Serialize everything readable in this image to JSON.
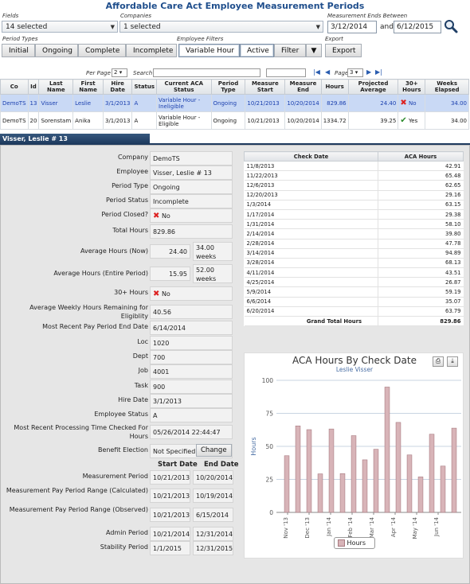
{
  "page": {
    "title": "Affordable Care Act Employee Measurement Periods"
  },
  "filters": {
    "fields_label": "Fields",
    "fields_value": "14 selected",
    "companies_label": "Companies",
    "companies_value": "1 selected",
    "measure_label": "Measurement Ends Between",
    "date_from": "3/12/2014",
    "and_label": "and",
    "date_to": "6/12/2015"
  },
  "period_types": {
    "label": "Period Types",
    "buttons": [
      "Initial",
      "Ongoing",
      "Complete",
      "Incomplete"
    ]
  },
  "employee_filters": {
    "label": "Employee Filters",
    "buttons": [
      "Variable Hour",
      "Active",
      "Filter"
    ]
  },
  "export": {
    "label": "Export",
    "button": "Export"
  },
  "pager": {
    "per_page_label": "Per Page",
    "per_page_value": "2",
    "search_label": "Search",
    "page_label": "Page",
    "page_value": "3"
  },
  "grid": {
    "headers": [
      "Co",
      "Id",
      "Last Name",
      "First Name",
      "Hire Date",
      "Status",
      "Current ACA Status",
      "Period Type",
      "Measure Start",
      "Measure End",
      "Hours",
      "Projected Average",
      "30+ Hours",
      "Weeks Elapsed"
    ],
    "rows": [
      [
        "DemoTS",
        "13",
        "Visser",
        "Leslie",
        "3/1/2013",
        "A",
        "Variable Hour - Ineligible",
        "Ongoing",
        "10/21/2013",
        "10/20/2014",
        "829.86",
        "24.40",
        "No",
        "34.00"
      ],
      [
        "DemoTS",
        "20",
        "Sorenstam",
        "Anika",
        "3/1/2013",
        "A",
        "Variable Hour - Eligible",
        "Ongoing",
        "10/21/2013",
        "10/20/2014",
        "1334.72",
        "39.25",
        "Yes",
        "34.00"
      ]
    ]
  },
  "detail": {
    "header": "Visser, Leslie # 13",
    "fields": {
      "company": {
        "label": "Company",
        "value": "DemoTS"
      },
      "employee": {
        "label": "Employee",
        "value": "Visser, Leslie # 13"
      },
      "period_type": {
        "label": "Period Type",
        "value": "Ongoing"
      },
      "period_status": {
        "label": "Period Status",
        "value": "Incomplete"
      },
      "period_closed": {
        "label": "Period Closed?",
        "value": "No"
      },
      "total_hours": {
        "label": "Total Hours",
        "value": "829.86"
      },
      "avg_now": {
        "label": "Average Hours (Now)",
        "value": "24.40",
        "weeks": "34.00 weeks"
      },
      "avg_entire": {
        "label": "Average Hours (Entire Period)",
        "value": "15.95",
        "weeks": "52.00 weeks"
      },
      "thirty_plus": {
        "label": "30+ Hours",
        "value": "No"
      },
      "avg_weekly_remaining": {
        "label": "Average Weekly Hours Remaining for Eligiblity",
        "value": "40.56"
      },
      "recent_pay_end": {
        "label": "Most Recent Pay Period End Date",
        "value": "6/14/2014"
      },
      "loc": {
        "label": "Loc",
        "value": "1020"
      },
      "dept": {
        "label": "Dept",
        "value": "700"
      },
      "job": {
        "label": "Job",
        "value": "4001"
      },
      "task": {
        "label": "Task",
        "value": "900"
      },
      "hire_date": {
        "label": "Hire Date",
        "value": "3/1/2013"
      },
      "emp_status": {
        "label": "Employee Status",
        "value": "A"
      },
      "recent_processing": {
        "label": "Most Recent Processing Time Checked For Hours",
        "value": "05/26/2014 22:44:47"
      },
      "benefit": {
        "label": "Benefit Election",
        "value": "Not Specified",
        "button": "Change"
      }
    },
    "periods": {
      "start_header": "Start Date",
      "end_header": "End Date",
      "rows": [
        {
          "label": "Measurement Period",
          "start": "10/21/2013",
          "end": "10/20/2014"
        },
        {
          "label": "Measurement Pay Period Range (Calculated)",
          "start": "10/21/2013",
          "end": "10/19/2014"
        },
        {
          "label": "Measurement Pay Period Range (Observed)",
          "start": "10/21/2013",
          "end": "6/15/2014"
        },
        {
          "label": "Admin Period",
          "start": "10/21/2014",
          "end": "12/31/2014"
        },
        {
          "label": "Stability Period",
          "start": "1/1/2015",
          "end": "12/31/2015"
        }
      ]
    }
  },
  "checks": {
    "headers": [
      "Check Date",
      "ACA Hours"
    ],
    "rows": [
      [
        "11/8/2013",
        "42.91"
      ],
      [
        "11/22/2013",
        "65.48"
      ],
      [
        "12/6/2013",
        "62.65"
      ],
      [
        "12/20/2013",
        "29.16"
      ],
      [
        "1/3/2014",
        "63.15"
      ],
      [
        "1/17/2014",
        "29.38"
      ],
      [
        "1/31/2014",
        "58.10"
      ],
      [
        "2/14/2014",
        "39.80"
      ],
      [
        "2/28/2014",
        "47.78"
      ],
      [
        "3/14/2014",
        "94.89"
      ],
      [
        "3/28/2014",
        "68.13"
      ],
      [
        "4/11/2014",
        "43.51"
      ],
      [
        "4/25/2014",
        "26.87"
      ],
      [
        "5/9/2014",
        "59.19"
      ],
      [
        "6/6/2014",
        "35.07"
      ],
      [
        "6/20/2014",
        "63.79"
      ]
    ],
    "total_label": "Grand Total Hours",
    "total_value": "829.86"
  },
  "chart_data": {
    "type": "bar",
    "title": "ACA Hours By Check Date",
    "subtitle": "Leslie Visser",
    "ylabel": "Hours",
    "ylim": [
      0,
      100
    ],
    "yticks": [
      0,
      25,
      50,
      75,
      100
    ],
    "xticks": [
      "Nov '13",
      "Dec '13",
      "Jan '14",
      "Feb '14",
      "Mar '14",
      "Apr '14",
      "May '14",
      "Jun '14"
    ],
    "categories": [
      "11/8/2013",
      "11/22/2013",
      "12/6/2013",
      "12/20/2013",
      "1/3/2014",
      "1/17/2014",
      "1/31/2014",
      "2/14/2014",
      "2/28/2014",
      "3/14/2014",
      "3/28/2014",
      "4/11/2014",
      "4/25/2014",
      "5/9/2014",
      "6/6/2014",
      "6/20/2014"
    ],
    "series": [
      {
        "name": "Hours",
        "values": [
          42.91,
          65.48,
          62.65,
          29.16,
          63.15,
          29.38,
          58.1,
          39.8,
          47.78,
          94.89,
          68.13,
          43.51,
          26.87,
          59.19,
          35.07,
          63.79
        ]
      }
    ],
    "legend": "bottom",
    "grid": true,
    "bar_color": "#d8b4b8"
  }
}
